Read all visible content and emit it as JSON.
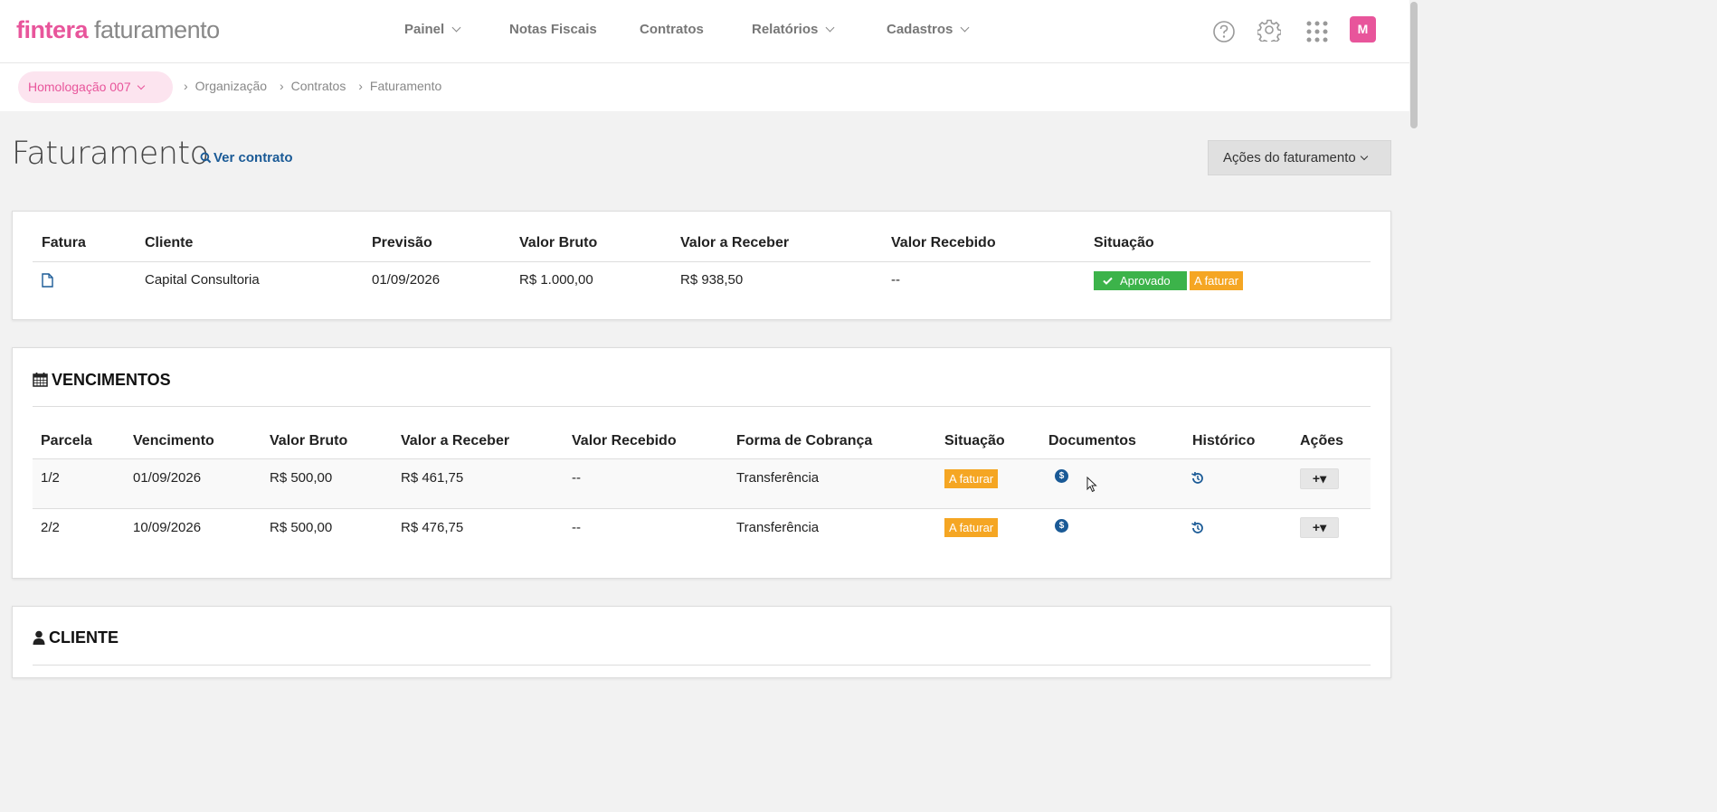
{
  "app": {
    "brand_primary": "fintera",
    "brand_secondary": " faturamento",
    "brand_color": "#e8559b"
  },
  "nav": {
    "items": [
      {
        "label": "Painel",
        "has_dropdown": true
      },
      {
        "label": "Notas Fiscais",
        "has_dropdown": false
      },
      {
        "label": "Contratos",
        "has_dropdown": false
      },
      {
        "label": "Relatórios",
        "has_dropdown": true
      },
      {
        "label": "Cadastros",
        "has_dropdown": true
      }
    ],
    "icons": [
      "help-icon",
      "gear-icon",
      "apps-grid-icon"
    ],
    "avatar_initial": "M"
  },
  "breadcrumb": {
    "organization": "Homologação 007",
    "items": [
      "Organização",
      "Contratos",
      "Faturamento"
    ]
  },
  "page": {
    "title": "Faturamento",
    "view_contract_link": "Ver contrato",
    "actions_button": "Ações do faturamento"
  },
  "invoice": {
    "headers": [
      "Fatura",
      "Cliente",
      "Previsão",
      "Valor Bruto",
      "Valor a Receber",
      "Valor Recebido",
      "Situação"
    ],
    "row": {
      "client": "Capital Consultoria",
      "forecast": "01/09/2026",
      "gross": "R$ 1.000,00",
      "receivable": "R$ 938,50",
      "received": "--",
      "status_approved": "Aprovado",
      "status_billing": "A faturar"
    }
  },
  "vencimentos": {
    "title": "VENCIMENTOS",
    "headers": [
      "Parcela",
      "Vencimento",
      "Valor Bruto",
      "Valor a Receber",
      "Valor Recebido",
      "Forma de Cobrança",
      "Situação",
      "Documentos",
      "Histórico",
      "Ações"
    ],
    "rows": [
      {
        "parcela": "1/2",
        "vencimento": "01/09/2026",
        "bruto": "R$ 500,00",
        "receber": "R$ 461,75",
        "recebido": "--",
        "forma": "Transferência",
        "situacao": "A faturar",
        "doc_symbol": "$",
        "action_label": "+▾"
      },
      {
        "parcela": "2/2",
        "vencimento": "10/09/2026",
        "bruto": "R$ 500,00",
        "receber": "R$ 476,75",
        "recebido": "--",
        "forma": "Transferência",
        "situacao": "A faturar",
        "doc_symbol": "$",
        "action_label": "+▾"
      }
    ]
  },
  "cliente": {
    "title": "CLIENTE"
  },
  "colors": {
    "approved": "#3cb34a",
    "to_bill": "#f5a623",
    "link": "#1a5a96"
  }
}
